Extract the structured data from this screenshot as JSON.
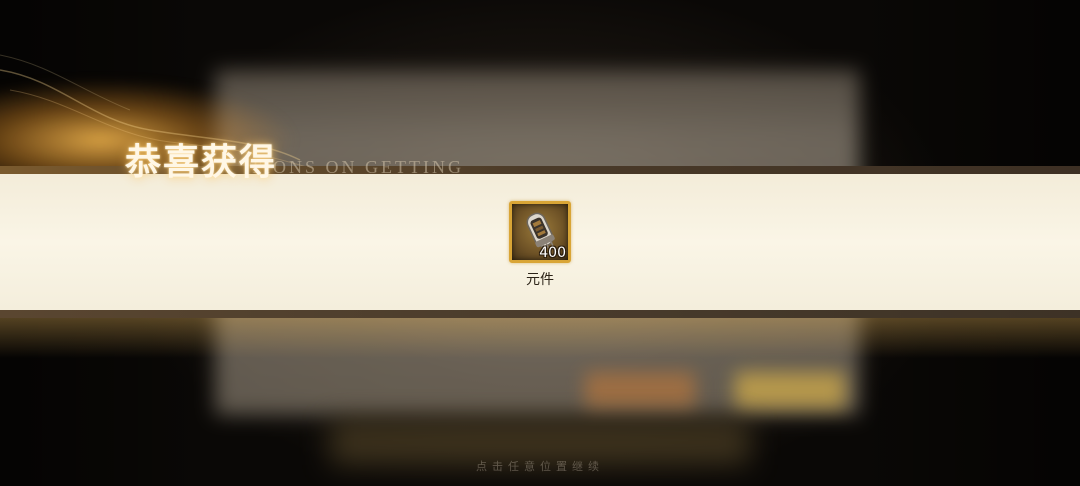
{
  "reward_popup": {
    "title": "恭喜获得",
    "subtitle": "TIONS ON GETTING",
    "hint": "点击任意位置继续",
    "items": [
      {
        "icon": "vacuum-tube-component-icon",
        "count": "400",
        "name": "元件"
      }
    ]
  },
  "colors": {
    "banner": "#faf5e6",
    "item_frame": "#d9a536",
    "title_glow": "#ffbe50"
  }
}
